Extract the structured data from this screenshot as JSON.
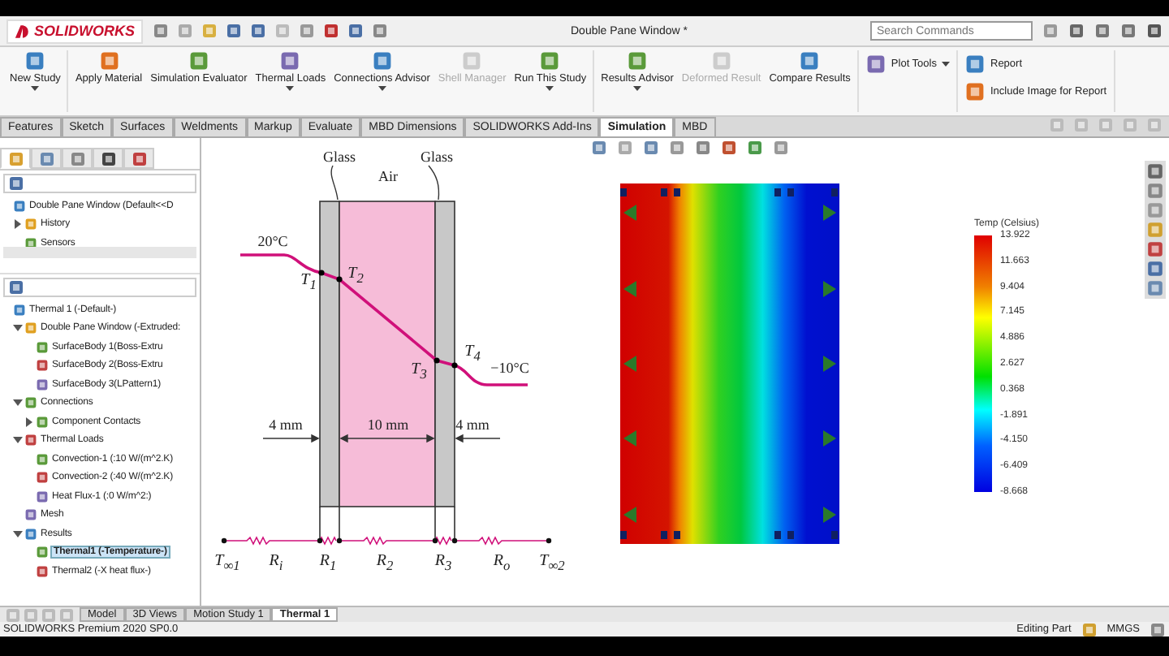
{
  "app": {
    "logo": "SOLIDWORKS",
    "title": "Double Pane Window *",
    "search": {
      "placeholder": "Search Commands"
    }
  },
  "ribbon": {
    "groups": [
      {
        "kind": "large",
        "buttons": [
          {
            "label": "New Study",
            "disabled": false,
            "dropdown": true
          }
        ]
      },
      {
        "kind": "large",
        "buttons": [
          {
            "label": "Apply Material",
            "disabled": false,
            "dropdown": false
          },
          {
            "label": "Simulation Evaluator",
            "disabled": false,
            "dropdown": false
          },
          {
            "label": "Thermal Loads",
            "disabled": false,
            "dropdown": true
          },
          {
            "label": "Connections Advisor",
            "disabled": false,
            "dropdown": true
          },
          {
            "label": "Shell Manager",
            "disabled": true,
            "dropdown": false
          },
          {
            "label": "Run This Study",
            "disabled": false,
            "dropdown": true
          }
        ]
      },
      {
        "kind": "large",
        "buttons": [
          {
            "label": "Results Advisor",
            "disabled": false,
            "dropdown": true
          },
          {
            "label": "Deformed Result",
            "disabled": true,
            "dropdown": false
          },
          {
            "label": "Compare Results",
            "disabled": false,
            "dropdown": false
          }
        ]
      },
      {
        "kind": "small",
        "buttons": [
          {
            "label": "Plot Tools",
            "disabled": false,
            "dropdown": true
          }
        ]
      },
      {
        "kind": "small",
        "buttons": [
          {
            "label": "Report",
            "disabled": false,
            "dropdown": false
          },
          {
            "label": "Include Image for Report",
            "disabled": false,
            "dropdown": false
          }
        ]
      }
    ]
  },
  "command_tabs": [
    {
      "label": "Features",
      "selected": false
    },
    {
      "label": "Sketch",
      "selected": false
    },
    {
      "label": "Surfaces",
      "selected": false
    },
    {
      "label": "Weldments",
      "selected": false
    },
    {
      "label": "Markup",
      "selected": false
    },
    {
      "label": "Evaluate",
      "selected": false
    },
    {
      "label": "MBD Dimensions",
      "selected": false
    },
    {
      "label": "SOLIDWORKS Add-Ins",
      "selected": false
    },
    {
      "label": "Simulation",
      "selected": true
    },
    {
      "label": "MBD",
      "selected": false
    }
  ],
  "panel_tabs": [
    {
      "selected": true
    },
    {
      "selected": false
    },
    {
      "selected": false
    },
    {
      "selected": false
    },
    {
      "selected": false
    }
  ],
  "feature_tree": [
    {
      "label": "Double Pane Window  (Default<<D",
      "selected": false,
      "children": [
        {
          "label": "History",
          "expanded": false,
          "selected": false
        },
        {
          "label": "Sensors",
          "selected": false
        }
      ]
    }
  ],
  "study_tree": [
    {
      "label": "Thermal 1 (-Default-)",
      "selected": false,
      "children": [
        {
          "label": "Double Pane Window (-Extruded:",
          "expanded": true,
          "selected": false,
          "children": [
            {
              "label": "SurfaceBody 1(Boss-Extru",
              "selected": false
            },
            {
              "label": "SurfaceBody 2(Boss-Extru",
              "selected": false
            },
            {
              "label": "SurfaceBody 3(LPattern1)",
              "selected": false
            }
          ]
        },
        {
          "label": "Connections",
          "expanded": true,
          "selected": false,
          "children": [
            {
              "label": "Component Contacts",
              "expanded": false,
              "selected": false
            }
          ]
        },
        {
          "label": "Thermal Loads",
          "expanded": true,
          "selected": false,
          "children": [
            {
              "label": "Convection-1 (:10 W/(m^2.K)",
              "selected": false
            },
            {
              "label": "Convection-2 (:40 W/(m^2.K)",
              "selected": false
            },
            {
              "label": "Heat Flux-1 (:0 W/m^2:)",
              "selected": false
            }
          ]
        },
        {
          "label": "Mesh",
          "selected": false
        },
        {
          "label": "Results",
          "expanded": true,
          "selected": false,
          "children": [
            {
              "label": "Thermal1 (-Temperature-)",
              "selected": true
            },
            {
              "label": "Thermal2 (-X heat flux-)",
              "selected": false
            }
          ]
        }
      ]
    }
  ],
  "diagram": {
    "labels": [
      {
        "text": "Glass",
        "kind": "text"
      },
      {
        "text": "Glass",
        "kind": "text"
      },
      {
        "text": "Air",
        "kind": "text"
      },
      {
        "text": "20°C",
        "kind": "text"
      },
      {
        "text": "T$_{1}$",
        "kind": "symbol"
      },
      {
        "text": "T$_{2}$",
        "kind": "symbol"
      },
      {
        "text": "T$_{3}$",
        "kind": "symbol"
      },
      {
        "text": "T$_{4}$",
        "kind": "symbol"
      },
      {
        "text": "−10°C",
        "kind": "text"
      },
      {
        "text": "4 mm",
        "kind": "text"
      },
      {
        "text": "10 mm",
        "kind": "text"
      },
      {
        "text": "4 mm",
        "kind": "text"
      },
      {
        "text": "T$_{∞1}$",
        "kind": "symbol"
      },
      {
        "text": "R$_{i}$",
        "kind": "symbol"
      },
      {
        "text": "R$_{1}$",
        "kind": "symbol"
      },
      {
        "text": "R$_{2}$",
        "kind": "symbol"
      },
      {
        "text": "R$_{3}$",
        "kind": "symbol"
      },
      {
        "text": "R$_{o}$",
        "kind": "symbol"
      },
      {
        "text": "T$_{∞2}$",
        "kind": "symbol"
      }
    ]
  },
  "legend": {
    "title": "Temp (Celsius)",
    "values": [
      "13.922",
      "11.663",
      "9.404",
      "7.145",
      "4.886",
      "2.627",
      "0.368",
      "-1.891",
      "-4.150",
      "-6.409",
      "-8.668"
    ]
  },
  "bottom_tabs": [
    {
      "label": "Model",
      "selected": false
    },
    {
      "label": "3D Views",
      "selected": false
    },
    {
      "label": "Motion Study 1",
      "selected": false
    },
    {
      "label": "Thermal 1",
      "selected": true
    }
  ],
  "status_bar": {
    "product": "SOLIDWORKS Premium 2020 SP0.0",
    "mode": "Editing Part",
    "units": "MMGS"
  }
}
